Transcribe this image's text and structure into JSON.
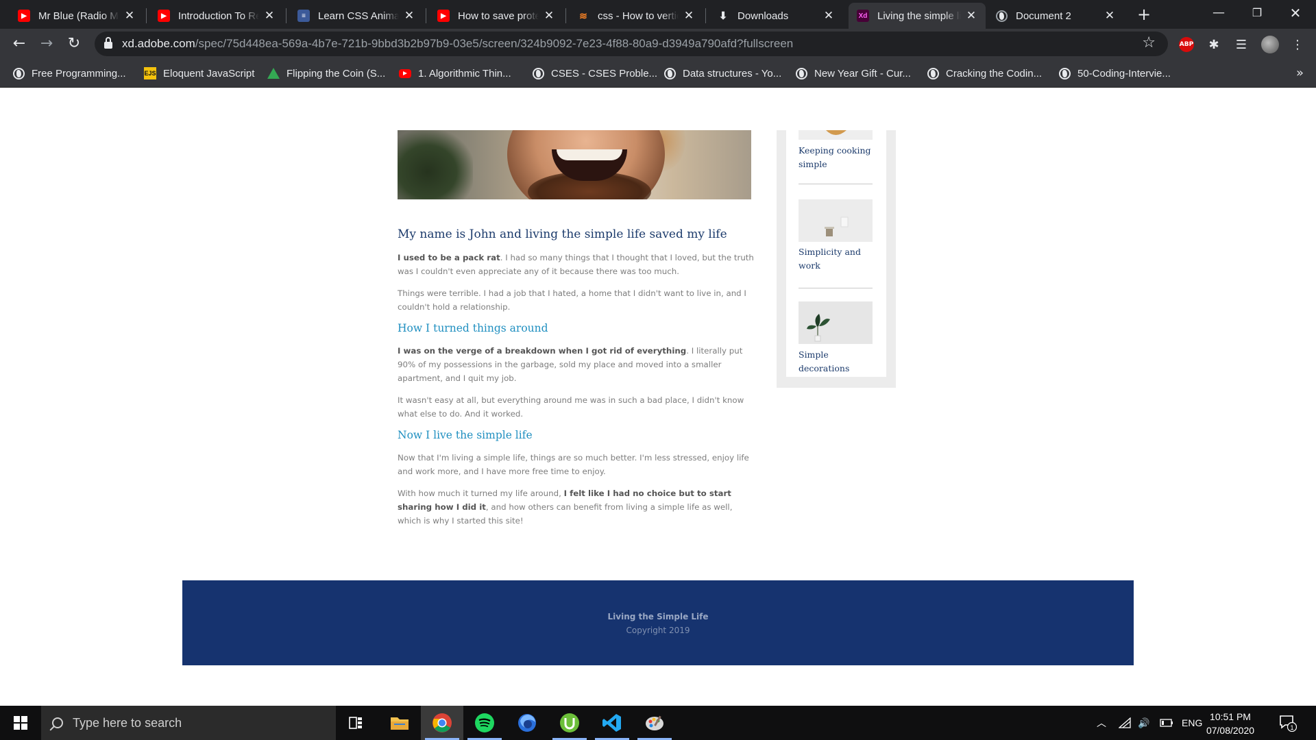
{
  "browser": {
    "tabs": [
      {
        "title": "Mr Blue (Radio Mix)",
        "icon": "youtube-icon"
      },
      {
        "title": "Introduction To React",
        "icon": "youtube-icon"
      },
      {
        "title": "Learn CSS Animation",
        "icon": "stack-icon"
      },
      {
        "title": "How to save protected",
        "icon": "youtube-icon"
      },
      {
        "title": "css - How to vertically",
        "icon": "stackoverflow-icon"
      },
      {
        "title": "Downloads",
        "icon": "download-icon"
      },
      {
        "title": "Living the simple life",
        "icon": "adobe-xd-icon",
        "active": true
      },
      {
        "title": "Document 2",
        "icon": "globe-icon"
      }
    ],
    "url_host": "xd.adobe.com",
    "url_path": "/spec/75d448ea-569a-4b7e-721b-9bbd3b2b97b9-03e5/screen/324b9092-7e23-4f88-80a9-d3949a790afd?fullscreen",
    "extension_abp_label": "ABP",
    "xd_badge": "Xd",
    "ejs_badge": "EJS",
    "bookmarks": [
      {
        "label": "Free Programming...",
        "icon": "globe-icon"
      },
      {
        "label": "Eloquent JavaScript",
        "icon": "ejs-icon"
      },
      {
        "label": "Flipping the Coin (S...",
        "icon": "google-drive-icon"
      },
      {
        "label": "1. Algorithmic Thin...",
        "icon": "youtube-icon"
      },
      {
        "label": "CSES - CSES Proble...",
        "icon": "globe-icon"
      },
      {
        "label": "Data structures - Yo...",
        "icon": "globe-icon"
      },
      {
        "label": "New Year Gift - Cur...",
        "icon": "globe-icon"
      },
      {
        "label": "Cracking the Codin...",
        "icon": "globe-icon"
      },
      {
        "label": "50-Coding-Intervie...",
        "icon": "globe-icon"
      }
    ]
  },
  "article": {
    "title": "My name is John and living the simple life saved my life",
    "p1_bold": "I used to be a pack rat",
    "p1_rest": ". I had so many things that I thought that I loved, but the truth was I couldn't even appreciate any of it because there was too much.",
    "p2": "Things were terrible. I had a job that I hated, a home that I didn't want to live in, and I couldn't hold a relationship.",
    "h2": "How I turned things around",
    "p3_bold": "I was on the verge of a breakdown when I got rid of everything",
    "p3_rest": ". I literally put 90% of my possessions in the garbage, sold my place and moved into a smaller apartment, and I quit my job.",
    "p4": "It wasn't easy at all, but everything around me was in such a bad place, I didn't know what else to do. And it worked.",
    "h3": "Now I live the simple life",
    "p5": "Now that I'm living a simple life, things are so much better. I'm less stressed, enjoy life and work more, and I have more free time to enjoy.",
    "p6_start": "With how much it turned my life around, ",
    "p6_bold": "I felt like I had no choice but to start sharing how I did it",
    "p6_rest": ", and how others can benefit from living a simple life as well, which is why I started this site!"
  },
  "sidebar": {
    "items": [
      {
        "label": "Keeping cooking simple"
      },
      {
        "label": "Simplicity and work"
      },
      {
        "label": "Simple decorations"
      }
    ]
  },
  "footer": {
    "title": "Living the Simple Life",
    "copyright": "Copyright 2019"
  },
  "taskbar": {
    "search_placeholder": "Type here to search",
    "language": "ENG",
    "time": "10:51 PM",
    "date": "07/08/2020",
    "notification_count": "1",
    "apps": [
      "task-view-icon",
      "file-explorer-icon",
      "chrome-icon",
      "spotify-icon",
      "firefox-icon",
      "utorrent-icon",
      "vscode-icon",
      "paint-icon"
    ]
  },
  "colors": {
    "heading": "#1b3a6b",
    "subheading": "#1f8fc0",
    "footer_bg": "#16336f"
  }
}
